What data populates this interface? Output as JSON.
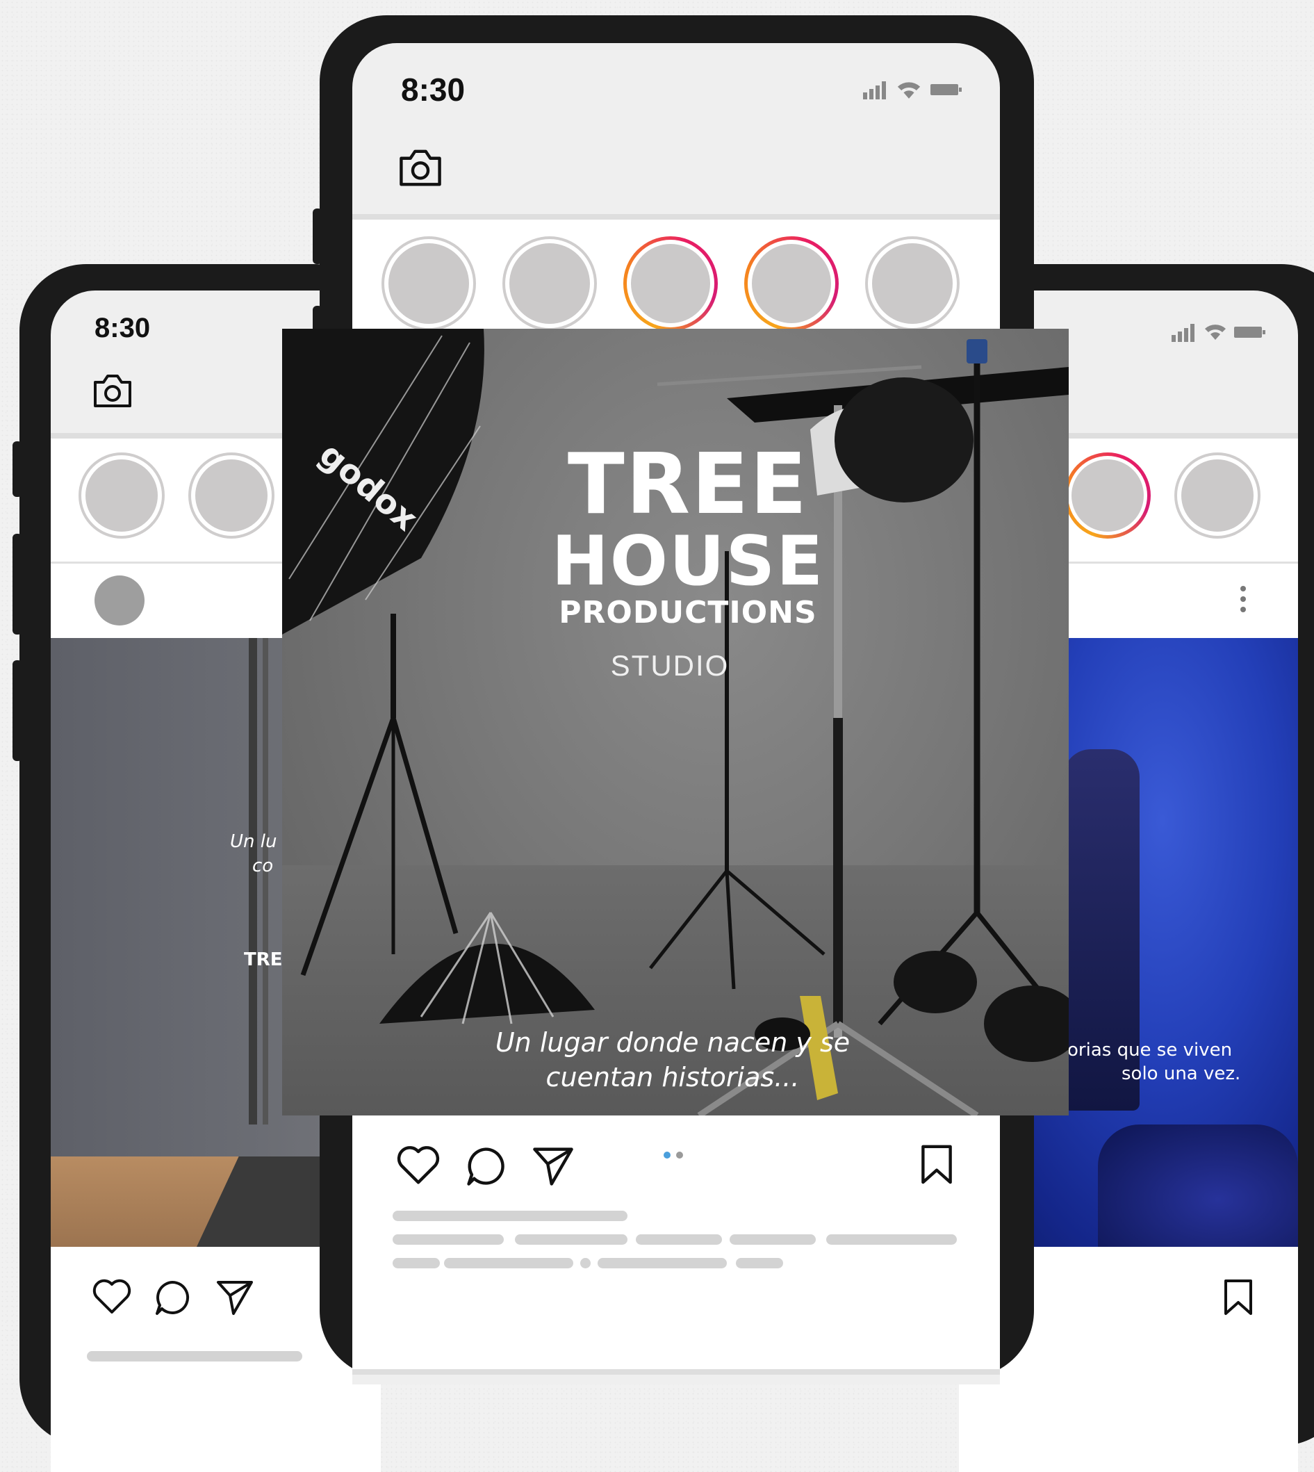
{
  "left_phone": {
    "time": "8:30",
    "overlay_line1": "Un lu",
    "overlay_line2": "co",
    "overlay_brand": "TRE"
  },
  "center_phone": {
    "time": "8:30",
    "post": {
      "brand_line1": "TREE",
      "brand_line2": "HOUSE",
      "brand_line3": "PRODUCTIONS",
      "brand_line4": "STUDIO",
      "tagline_line1": "Un lugar donde nacen y se",
      "tagline_line2": "cuentan historias...",
      "gear_brand": "godox"
    },
    "carousel": {
      "count": 2,
      "active": 1
    }
  },
  "right_phone": {
    "overlay_line1": "orias que se viven",
    "overlay_line2": "solo una vez."
  },
  "colors": {
    "phone_frame": "#1b1b1b",
    "story_ring_gradient_start": "#f7a51c",
    "story_ring_gradient_end": "#e91e63",
    "carousel_active_dot": "#4a9fdc"
  },
  "icons": [
    "camera-icon",
    "signal-icon",
    "wifi-icon",
    "battery-icon",
    "heart-icon",
    "comment-icon",
    "send-icon",
    "bookmark-icon",
    "more-icon"
  ]
}
